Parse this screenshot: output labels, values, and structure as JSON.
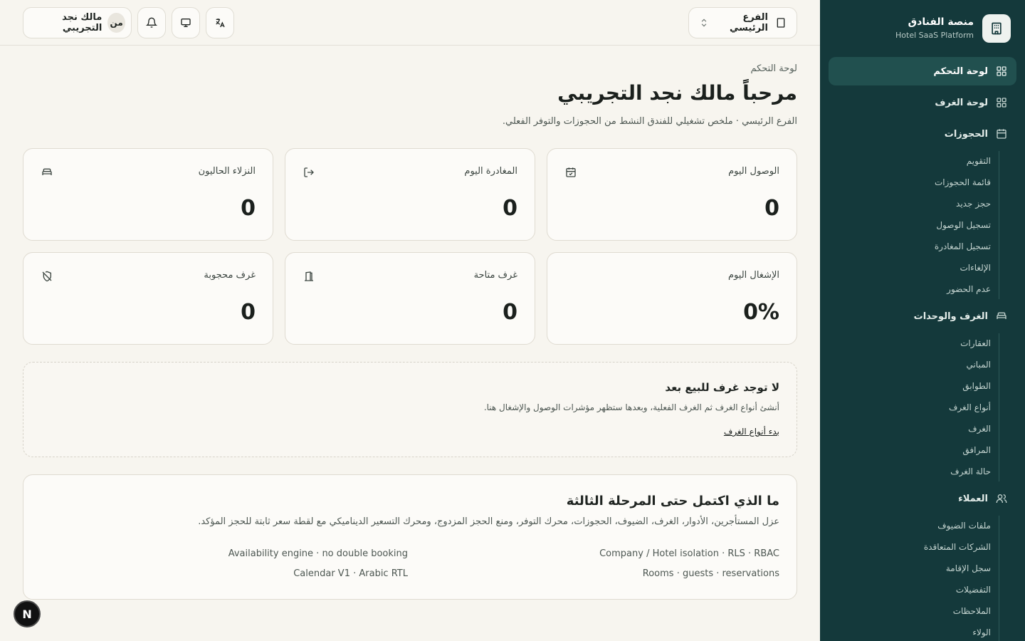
{
  "brand": {
    "name": "منصة الفنادق",
    "subtitle": "Hotel SaaS Platform"
  },
  "sidebar": {
    "dashboard": "لوحة التحكم",
    "rooms_board": "لوحة الغرف",
    "reservations": {
      "label": "الحجوزات",
      "items": [
        "التقويم",
        "قائمة الحجوزات",
        "حجز جديد",
        "تسجيل الوصول",
        "تسجيل المغادرة",
        "الإلغاءات",
        "عدم الحضور"
      ]
    },
    "rooms_units": {
      "label": "الغرف والوحدات",
      "items": [
        "العقارات",
        "المباني",
        "الطوابق",
        "أنواع الغرف",
        "الغرف",
        "المرافق",
        "حالة الغرف"
      ]
    },
    "customers": {
      "label": "العملاء",
      "items": [
        "ملفات الضيوف",
        "الشركات المتعاقدة",
        "سجل الإقامة",
        "التفضيلات",
        "الملاحظات",
        "الولاء"
      ]
    }
  },
  "topbar": {
    "branch": "الفرع الرئيسي",
    "user_name": "مالك نجد التجريبي",
    "user_initials": "من"
  },
  "header": {
    "breadcrumb": "لوحة التحكم",
    "title": "مرحباً مالك نجد التجريبي",
    "subtitle": "الفرع الرئيسي · ملخص تشغيلي للفندق النشط من الحجوزات والتوفر الفعلي."
  },
  "stats": [
    {
      "label": "الوصول اليوم",
      "value": "0",
      "icon": "calendar-check-icon"
    },
    {
      "label": "المغادرة اليوم",
      "value": "0",
      "icon": "log-out-icon"
    },
    {
      "label": "النزلاء الحاليون",
      "value": "0",
      "icon": "bed-icon"
    },
    {
      "label": "الإشغال اليوم",
      "value": "0%",
      "icon": ""
    },
    {
      "label": "غرف متاحة",
      "value": "0",
      "icon": "door-open-icon"
    },
    {
      "label": "غرف محجوبة",
      "value": "0",
      "icon": "shield-off-icon"
    }
  ],
  "empty_state": {
    "title": "لا توجد غرف للبيع بعد",
    "description": "أنشئ أنواع الغرف ثم الغرف الفعلية، وبعدها ستظهر مؤشرات الوصول والإشغال هنا.",
    "link": "بدء أنواع الغرف"
  },
  "phase": {
    "title": "ما الذي اكتمل حتى المرحلة الثالثة",
    "description": "عزل المستأجرين، الأدوار، الغرف، الضيوف، الحجوزات، محرك التوفر، ومنع الحجز المزدوج، ومحرك التسعير الديناميكي مع لقطة سعر ثابتة للحجز المؤكد.",
    "features": [
      "Company / Hotel isolation · RLS · RBAC",
      "Availability engine · no double booking",
      "Rooms · guests · reservations",
      "Calendar V1 · Arabic RTL"
    ]
  },
  "badge": "N"
}
